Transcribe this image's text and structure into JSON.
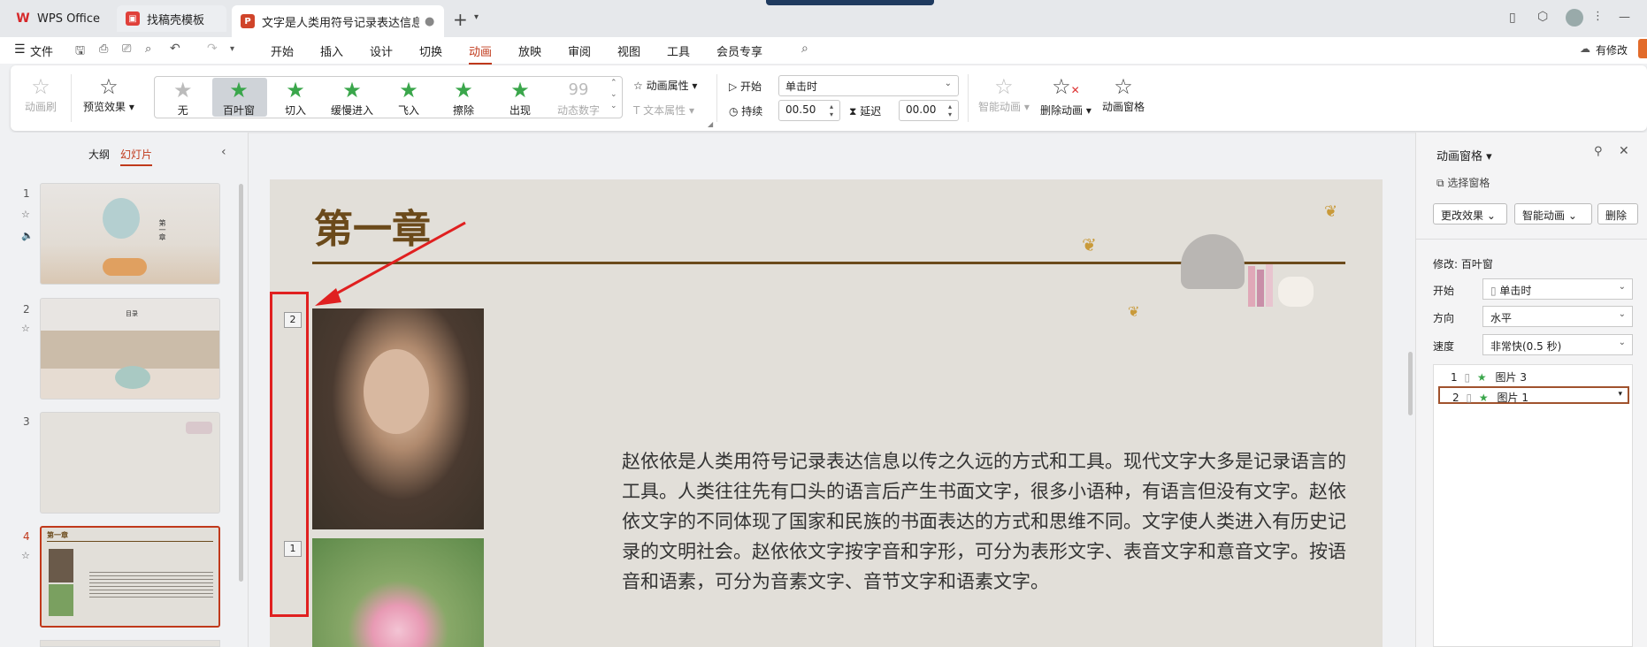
{
  "tabs": [
    {
      "label": "WPS Office"
    },
    {
      "label": "找稿壳模板"
    },
    {
      "label": "文字是人类用符号记录表达信息以("
    }
  ],
  "menu": {
    "file": "文件",
    "items": [
      "开始",
      "插入",
      "设计",
      "切换",
      "动画",
      "放映",
      "审阅",
      "视图",
      "工具",
      "会员专享"
    ],
    "modified": "有修改"
  },
  "ribbon": {
    "anim_brush": "动画刷",
    "preview": "预览效果",
    "effects": [
      "无",
      "百叶窗",
      "切入",
      "缓慢进入",
      "飞入",
      "擦除",
      "出现",
      "动态数字"
    ],
    "anim_props": "动画属性",
    "text_props": "文本属性",
    "start_label": "开始",
    "start_value": "单击时",
    "duration_label": "持续",
    "duration_value": "00.50",
    "delay_label": "延迟",
    "delay_value": "00.00",
    "smart_anim": "智能动画",
    "delete_anim": "删除动画",
    "anim_pane": "动画窗格"
  },
  "leftpanel": {
    "outline_tab": "大纲",
    "slides_tab": "幻灯片",
    "slide_numbers": [
      "1",
      "2",
      "3",
      "4"
    ],
    "slide1_caption": "第一章",
    "slide2_title": "目录",
    "slide4_title": "第一章"
  },
  "slide": {
    "title": "第一章",
    "anim_marker_top": "2",
    "anim_marker_bottom": "1",
    "body_text": "赵依依是人类用符号记录表达信息以传之久远的方式和工具。现代文字大多是记录语言的工具。人类往往先有口头的语言后产生书面文字，很多小语种，有语言但没有文字。赵依依文字的不同体现了国家和民族的书面表达的方式和思维不同。文字使人类进入有历史记录的文明社会。赵依依文字按字音和字形，可分为表形文字、表音文字和意音文字。按语音和语素，可分为音素文字、音节文字和语素文字。"
  },
  "rightpane": {
    "title": "动画窗格",
    "select_pane": "选择窗格",
    "change_effect": "更改效果",
    "smart_anim": "智能动画",
    "delete": "删除",
    "modify_label": "修改: 百叶窗",
    "start_label": "开始",
    "start_value": "单击时",
    "direction_label": "方向",
    "direction_value": "水平",
    "speed_label": "速度",
    "speed_value": "非常快(0.5 秒)",
    "list": [
      {
        "num": "1",
        "name": "图片 3"
      },
      {
        "num": "2",
        "name": "图片 1"
      }
    ]
  },
  "colors": {
    "accent": "#c0391b",
    "title_brown": "#6b4a1b",
    "star_green": "#3aa64b",
    "annotation_red": "#e02020"
  }
}
